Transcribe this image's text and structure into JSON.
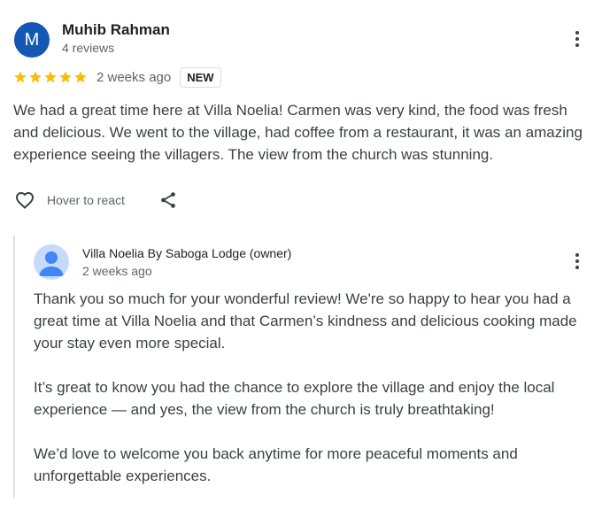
{
  "review": {
    "author_initial": "M",
    "author_name": "Muhib Rahman",
    "author_reviews": "4 reviews",
    "rating": 5,
    "date": "2 weeks ago",
    "badge": "NEW",
    "text": "We had a great time here at Villa Noelia! Carmen was very kind, the food was fresh and delicious. We went to the village, had coffee from a restaurant, it was an amazing experience seeing the villagers. The view from the church was stunning.",
    "react_label": "Hover to react"
  },
  "owner_reply": {
    "name": "Villa Noelia By Saboga Lodge (owner)",
    "date": "2 weeks ago",
    "paragraphs": [
      "Thank you so much for your wonderful review! We're so happy to hear you had a great time at Villa Noelia and that Carmen’s kindness and delicious cooking made your stay even more special.",
      "It’s great to know you had the chance to explore the village and enjoy the local experience — and yes, the view from the church is truly breathtaking!",
      "We’d love to welcome you back anytime for more peaceful moments and unforgettable experiences."
    ]
  },
  "icons": {
    "star": "star-icon",
    "more": "more-vert-icon",
    "heart": "heart-outline-icon",
    "share": "share-icon",
    "person": "person-icon"
  },
  "colors": {
    "avatar_bg": "#1558b4",
    "star": "#fbbc04",
    "reply_avatar_bg": "#c6dafc",
    "reply_avatar_fg": "#4285f4"
  }
}
